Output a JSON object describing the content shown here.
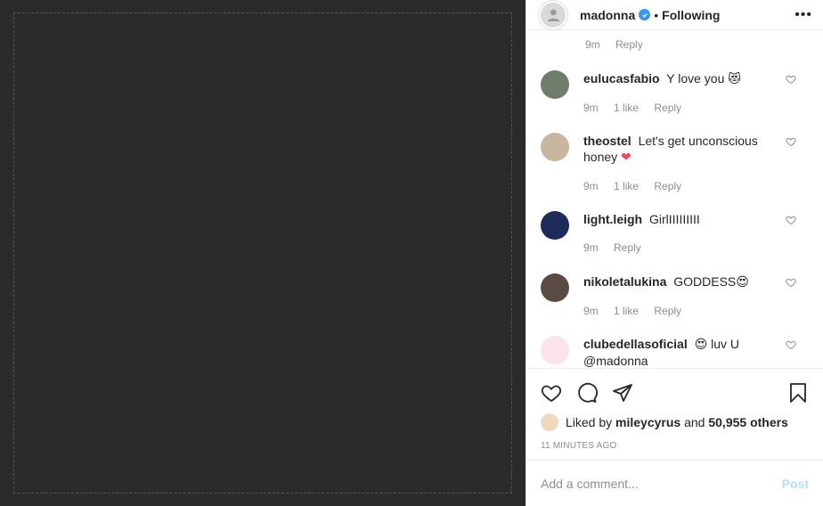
{
  "header": {
    "username": "madonna",
    "separator": "•",
    "follow_status": "Following",
    "more_icon": "more-horizontal-icon",
    "more_label": "•••"
  },
  "cut_comment": {
    "time": "9m",
    "reply": "Reply"
  },
  "comments": [
    {
      "user": "eulucasfabio",
      "text": "Y love you",
      "emoji": "😻",
      "time": "9m",
      "likes": "1 like",
      "reply": "Reply"
    },
    {
      "user": "theostel",
      "text": "Let's get unconscious honey",
      "emoji": "❤",
      "time": "9m",
      "likes": "1 like",
      "reply": "Reply"
    },
    {
      "user": "light.leigh",
      "text": "GirlIIIIIIIII",
      "emoji": "",
      "time": "9m",
      "likes": "",
      "reply": "Reply"
    },
    {
      "user": "nikoletalukina",
      "text": "GODDESS",
      "emoji": "😍",
      "time": "9m",
      "likes": "1 like",
      "reply": "Reply"
    },
    {
      "user": "clubedellasoficial",
      "text": "luv U @madonna",
      "emoji": "😍",
      "time": "",
      "likes": "",
      "reply": ""
    }
  ],
  "likes": {
    "prefix": "Liked by",
    "user": "mileycyrus",
    "conjunction": "and",
    "count": "50,955 others"
  },
  "timestamp": "11 MINUTES AGO",
  "add_comment": {
    "placeholder": "Add a comment...",
    "post_label": "Post"
  },
  "photo": {
    "description": "Post image"
  },
  "colors": {
    "accent": "#3897f0",
    "post_disabled": "#b2dffc",
    "heart": "#ed4956",
    "muted": "#8e8e8e"
  }
}
